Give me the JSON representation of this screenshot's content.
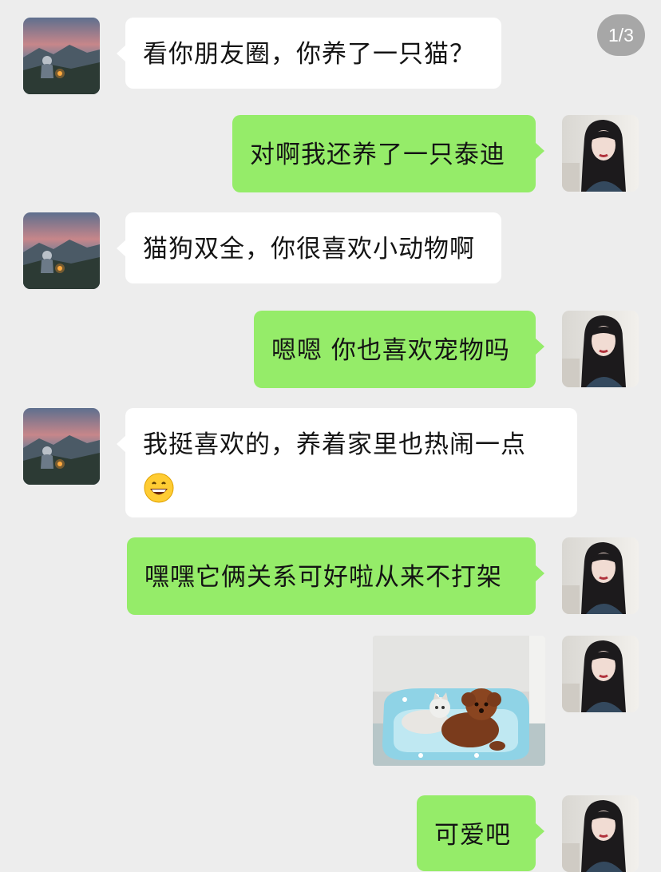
{
  "page_indicator": "1/3",
  "contact_avatar_icon": "mountain-campfire-photo",
  "self_avatar_icon": "girl-portrait-photo",
  "messages": [
    {
      "side": "left",
      "text": "看你朋友圈，你养了一只猫？"
    },
    {
      "side": "right",
      "text": "对啊我还养了一只泰迪"
    },
    {
      "side": "left",
      "text": "猫狗双全，你很喜欢小动物啊"
    },
    {
      "side": "right",
      "text": "嗯嗯 你也喜欢宠物吗"
    },
    {
      "side": "left",
      "text": "我挺喜欢的，养着家里也热闹一点",
      "emoji": "grinning-face-emoji"
    },
    {
      "side": "right",
      "text": "嘿嘿它俩关系可好啦从来不打架"
    },
    {
      "side": "right",
      "image": "cat-and-poodle-on-pet-bed-photo"
    },
    {
      "side": "right",
      "text": "可爱吧"
    }
  ],
  "colors": {
    "background": "#ededed",
    "incoming_bubble": "#ffffff",
    "outgoing_bubble": "#95ec69"
  }
}
